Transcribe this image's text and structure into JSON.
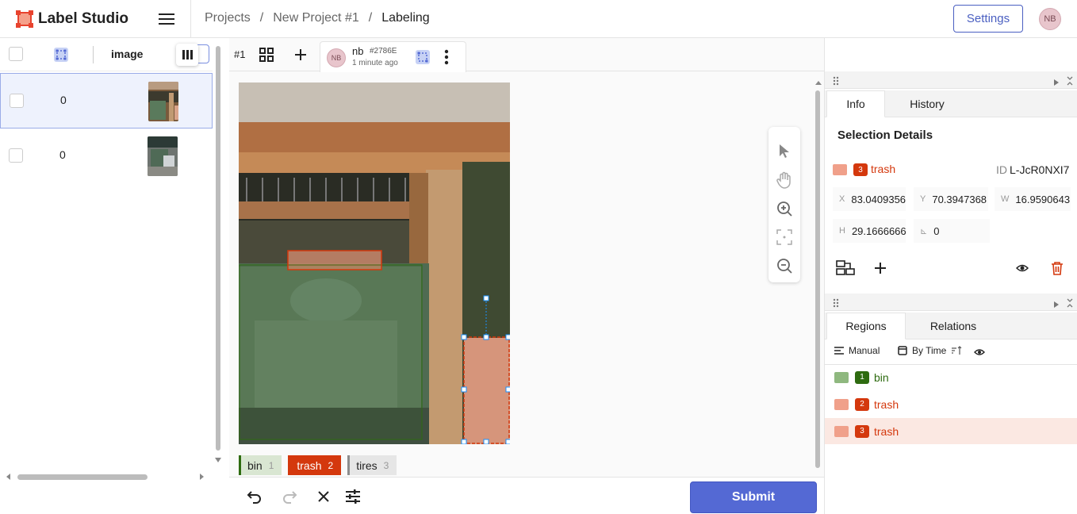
{
  "app": {
    "title": "Label Studio"
  },
  "breadcrumb": {
    "projects": "Projects",
    "sep": "/",
    "project": "New Project #1",
    "page": "Labeling"
  },
  "header": {
    "settings_label": "Settings",
    "user_initials": "NB"
  },
  "task_list": {
    "column_label": "image",
    "rows": [
      {
        "count": "0",
        "selected": true
      },
      {
        "count": "0",
        "selected": false
      }
    ]
  },
  "annotation_tabs": {
    "task_id": "#1",
    "active": {
      "user": "nb",
      "annotation_id": "#2786E",
      "time": "1 minute ago",
      "initials": "NB"
    }
  },
  "labels": [
    {
      "name": "bin",
      "hotkey": "1",
      "color": "#2e6b10",
      "bg": "#d9e6d2",
      "fg": "#222222"
    },
    {
      "name": "trash",
      "hotkey": "2",
      "color": "#d4380d",
      "bg": "#d4380d",
      "fg": "#ffffff"
    },
    {
      "name": "tires",
      "hotkey": "3",
      "color": "#8c8c8c",
      "bg": "#e6e6e6",
      "fg": "#222222"
    }
  ],
  "actions": {
    "submit_label": "Submit"
  },
  "panel_info": {
    "tabs": [
      "Info",
      "History"
    ],
    "title": "Selection Details",
    "region": {
      "index": "3",
      "label": "trash",
      "id_label": "ID",
      "id": "L-JcR0NXI7"
    },
    "fields": {
      "x_label": "X",
      "x": "83.0409356",
      "y_label": "Y",
      "y": "70.3947368",
      "w_label": "W",
      "w": "16.9590643",
      "h_label": "H",
      "h": "29.1666666",
      "r_label": "⊾",
      "r": "0"
    }
  },
  "panel_regions": {
    "tabs": [
      "Regions",
      "Relations"
    ],
    "grouping": "Manual",
    "ordering": "By Time",
    "items": [
      {
        "index": "1",
        "label": "bin",
        "color": "#2e6b10",
        "swatch": "#8fb87f"
      },
      {
        "index": "2",
        "label": "trash",
        "color": "#d4380d",
        "swatch": "#f0a08a"
      },
      {
        "index": "3",
        "label": "trash",
        "color": "#d4380d",
        "swatch": "#f0a08a"
      }
    ]
  },
  "colors": {
    "accent": "#5469d4",
    "trash": "#d4380d",
    "bin": "#2e6b10",
    "selected_row": "#fbe8e2"
  }
}
